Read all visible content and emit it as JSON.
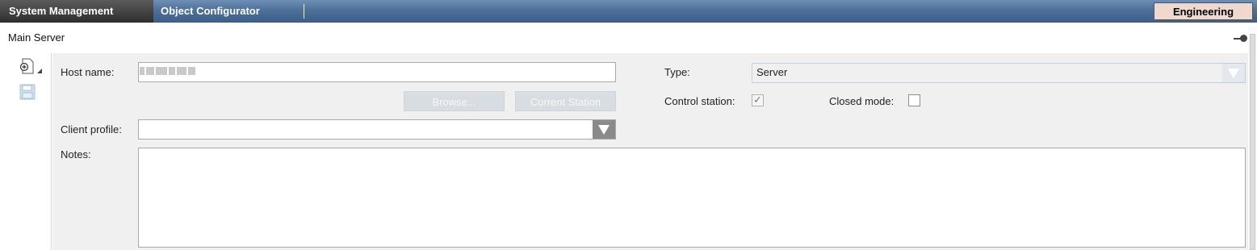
{
  "topbar": {
    "tabs": [
      {
        "label": "System Management",
        "active": true
      },
      {
        "label": "Object Configurator",
        "active": false
      }
    ],
    "mode_label": "Engineering"
  },
  "header": {
    "title": "Main Server",
    "pin_icon": "pin-icon"
  },
  "toolbar": {
    "icons": [
      "add-object-icon",
      "save-icon"
    ]
  },
  "form": {
    "host_name": {
      "label": "Host name:",
      "value": ""
    },
    "browse_label": "Browse...",
    "current_station_label": "Current Station",
    "client_profile": {
      "label": "Client profile:",
      "value": ""
    },
    "notes": {
      "label": "Notes:",
      "value": ""
    },
    "type": {
      "label": "Type:",
      "value": "Server"
    },
    "control_station": {
      "label": "Control station:",
      "checked": true
    },
    "closed_mode": {
      "label": "Closed mode:",
      "checked": false
    }
  },
  "colors": {
    "topbar": "#4d7099",
    "active_tab": "#3a3a3a",
    "mode_badge": "#efd9cf",
    "panel": "#f0f0f0",
    "combo_button": "#8a8a8a"
  }
}
